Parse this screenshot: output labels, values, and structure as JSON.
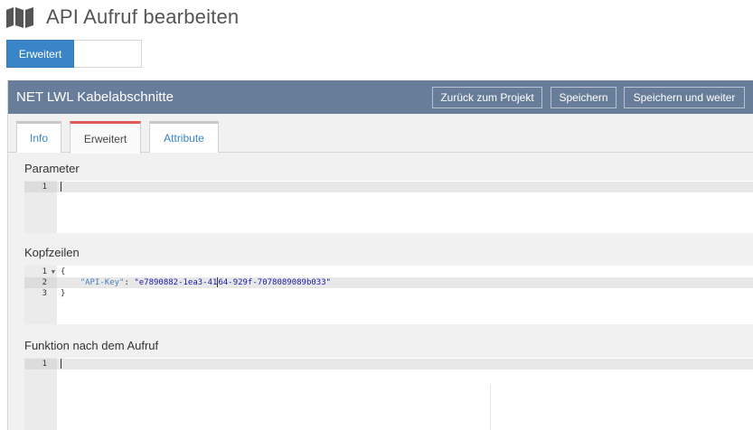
{
  "page": {
    "title": "API Aufruf bearbeiten"
  },
  "mode_toggle": {
    "active_label": "Erweitert"
  },
  "panel": {
    "title": "NET LWL Kabelabschnitte",
    "buttons": {
      "back": "Zurück zum Projekt",
      "save": "Speichern",
      "save_continue": "Speichern und weiter"
    }
  },
  "tabs": [
    {
      "label": "Info"
    },
    {
      "label": "Erweitert"
    },
    {
      "label": "Attribute"
    }
  ],
  "sections": {
    "parameter": {
      "label": "Parameter",
      "line_numbers": [
        "1"
      ]
    },
    "kopfzeilen": {
      "label": "Kopfzeilen",
      "line_numbers": [
        "1",
        "2",
        "3"
      ],
      "open_brace": "{",
      "indent": "    ",
      "key": "\"API-Key\"",
      "colon": ": ",
      "value_before_cursor": "\"e7890882-1ea3-41",
      "value_after_cursor": "64-929f-7078089089b033\"",
      "close_brace": "}"
    },
    "funktion": {
      "label": "Funktion nach dem Aufruf",
      "line_numbers": [
        "1"
      ]
    }
  },
  "colors": {
    "accent": "#3a85c8",
    "panel_header": "#687d99",
    "active_tab_top": "#e05a5a"
  },
  "icons": {
    "header": "map-icon",
    "fold": "fold-arrow-icon"
  }
}
